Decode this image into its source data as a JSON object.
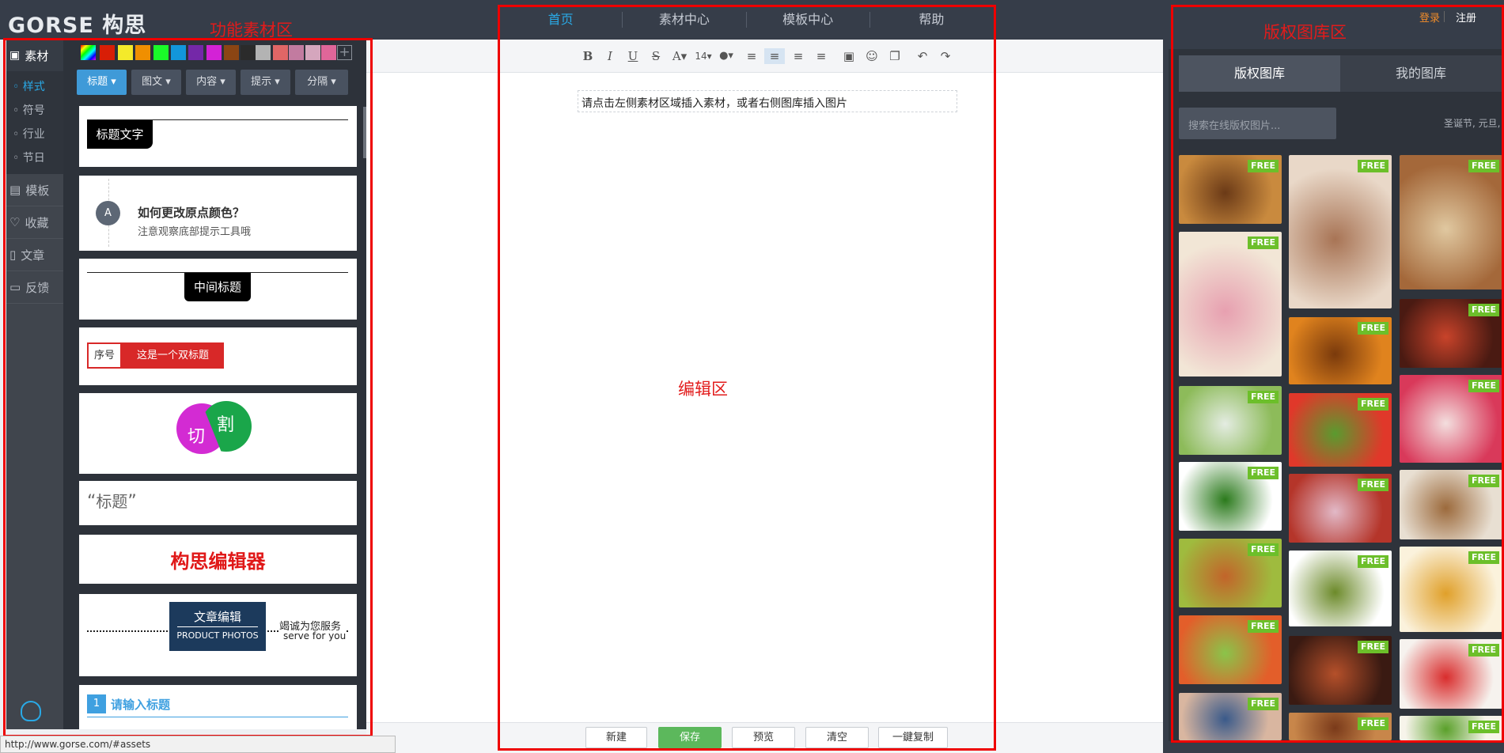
{
  "app": {
    "logo": "GORSE 构思"
  },
  "nav": [
    "首页",
    "素材中心",
    "模板中心",
    "帮助"
  ],
  "auth": {
    "login": "登录",
    "register": "注册"
  },
  "sidebar": {
    "top": "素材",
    "sub": [
      "样式",
      "符号",
      "行业",
      "节日"
    ],
    "items": [
      "模板",
      "收藏",
      "文章",
      "反馈"
    ]
  },
  "material_tabs": [
    "标题",
    "图文",
    "内容",
    "提示",
    "分隔"
  ],
  "colors": [
    "#d81e06",
    "#f4ea2a",
    "#f08f00",
    "#1afa29",
    "#1296db",
    "#7428a8",
    "#d322d6",
    "#8b4513",
    "#2b2b2b",
    "#b3b3b3",
    "#e06666",
    "#c27ba0",
    "#d5a6bd",
    "#e06699"
  ],
  "cards": {
    "title_text": "标题文字",
    "circle_letter": "A",
    "question": "如何更改原点颜色？",
    "question_sub": "注意观察底部提示工具哦",
    "middle_title": "中间标题",
    "seq": "序号",
    "double_title": "这是一个双标题",
    "cut1": "切",
    "cut2": "割",
    "quote_title": "标题",
    "editor_name": "构思编辑器",
    "article_edit": "文章编辑",
    "product": "PRODUCT PHOTOS",
    "serve": "竭诚为您服务",
    "serve_en": "serve for you",
    "num": "1",
    "input_title": "请输入标题"
  },
  "editor": {
    "placeholder": "请点击左侧素材区域插入素材，或者右侧图库插入图片",
    "font_size": "14",
    "label": "编辑区"
  },
  "bottom_buttons": [
    "新建",
    "保存",
    "预览",
    "清空",
    "一鍵复制"
  ],
  "library": {
    "tabs": [
      "版权图库",
      "我的图库"
    ],
    "search_placeholder": "搜索在线版权图片...",
    "hint": "圣诞节, 元旦,",
    "free": "FREE"
  },
  "annotations": {
    "left": "功能素材区",
    "right": "版权图库区"
  },
  "status_url": "http://www.gorse.com/#assets"
}
